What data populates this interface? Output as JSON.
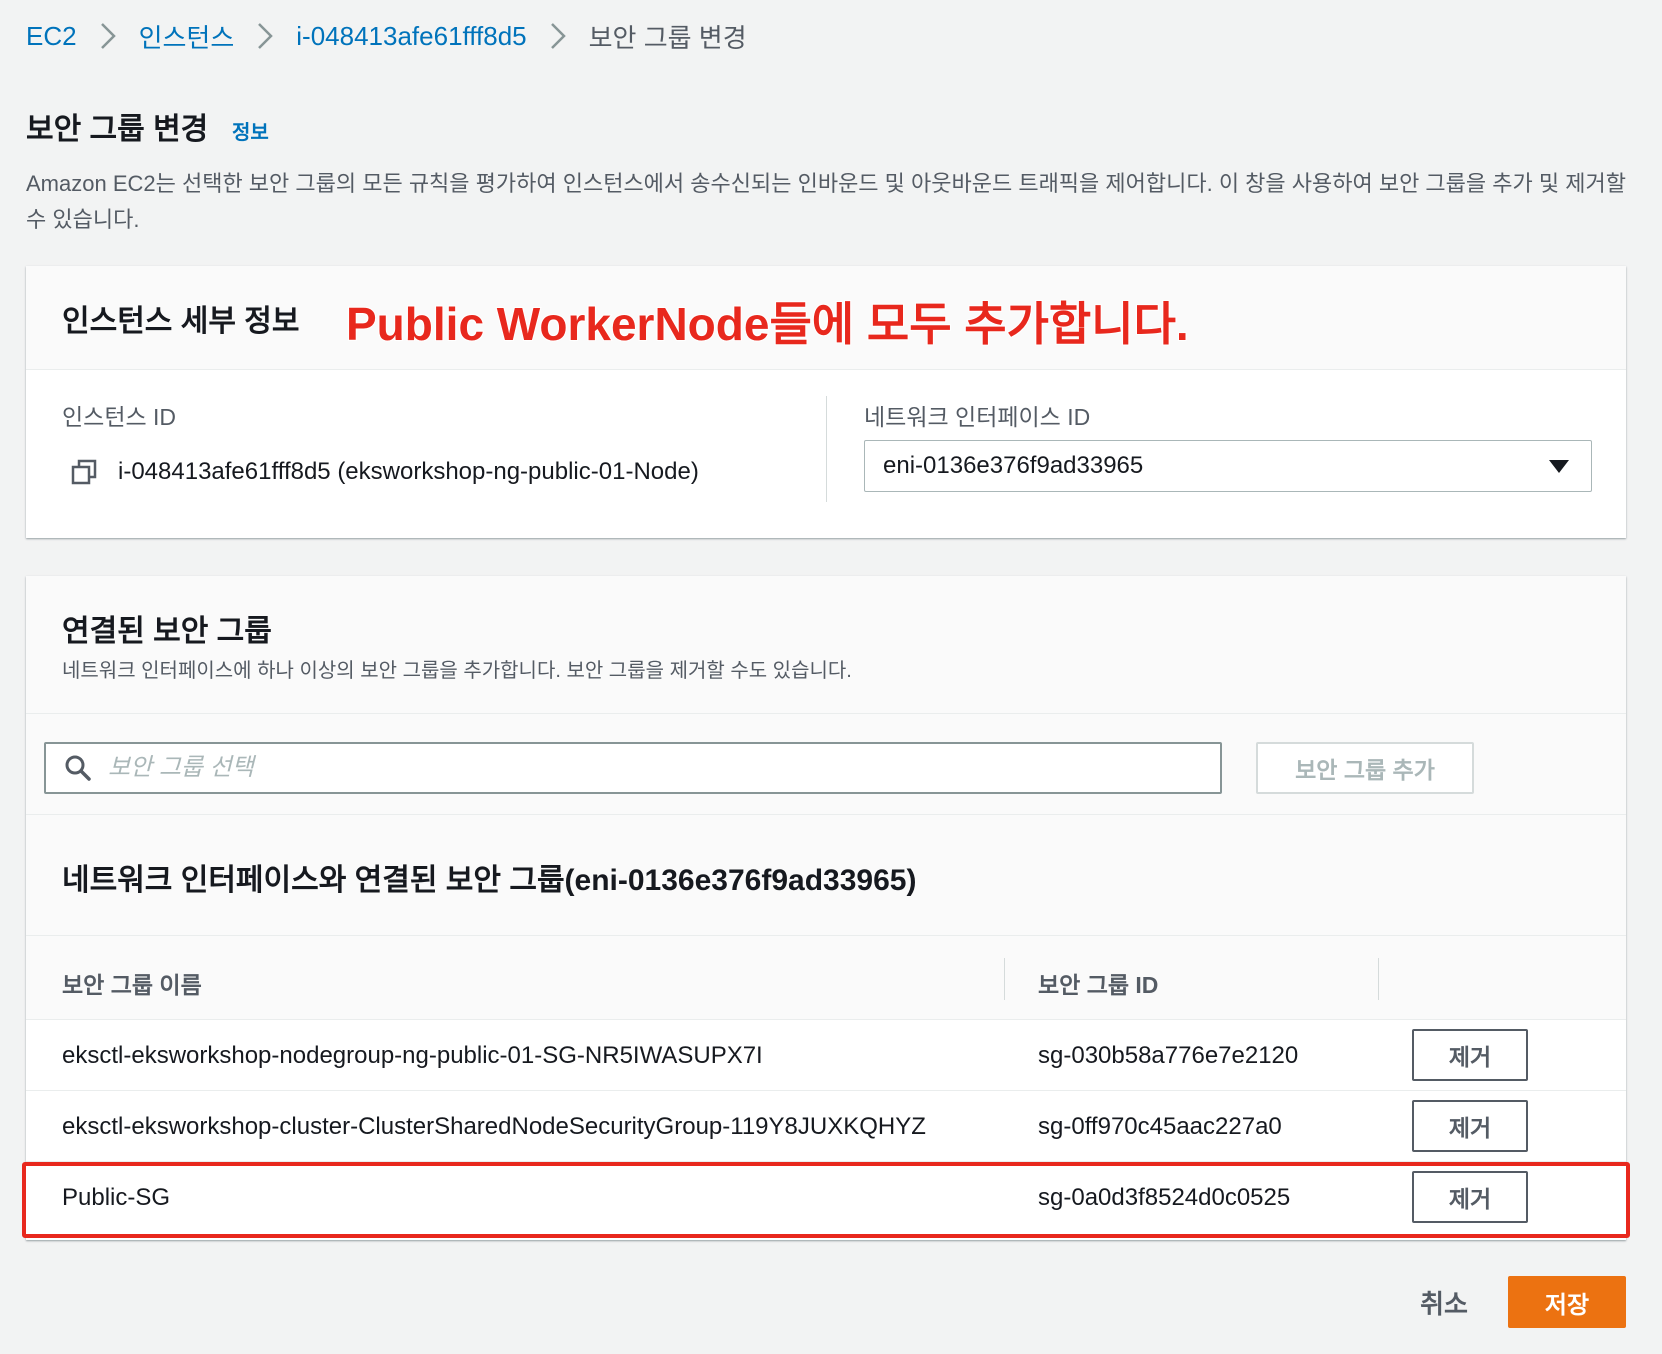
{
  "breadcrumb": {
    "items": [
      "EC2",
      "인스턴스",
      "i-048413afe61fff8d5"
    ],
    "current": "보안 그룹 변경"
  },
  "page": {
    "title": "보안 그룹 변경",
    "info_link": "정보",
    "description": "Amazon EC2는 선택한 보안 그룹의 모든 규칙을 평가하여 인스턴스에서 송수신되는 인바운드 및 아웃바운드 트래픽을 제어합니다. 이 창을 사용하여 보안 그룹을 추가 및 제거할 수 있습니다."
  },
  "instance_details": {
    "title": "인스턴스 세부 정보",
    "annotation": "Public WorkerNode들에 모두 추가합니다.",
    "instance_id_label": "인스턴스 ID",
    "instance_id_value": "i-048413afe61fff8d5 (eksworkshop-ng-public-01-Node)",
    "eni_label": "네트워크 인터페이스 ID",
    "eni_value": "eni-0136e376f9ad33965"
  },
  "security_groups": {
    "title": "연결된 보안 그룹",
    "subtitle": "네트워크 인터페이스에 하나 이상의 보안 그룹을 추가합니다. 보안 그룹을 제거할 수도 있습니다.",
    "search_placeholder": "보안 그룹 선택",
    "add_button": "보안 그룹 추가",
    "table_title": "네트워크 인터페이스와 연결된 보안 그룹(eni-0136e376f9ad33965)",
    "columns": [
      "보안 그룹 이름",
      "보안 그룹 ID"
    ],
    "rows": [
      {
        "name": "eksctl-eksworkshop-nodegroup-ng-public-01-SG-NR5IWASUPX7I",
        "id": "sg-030b58a776e7e2120",
        "action": "제거"
      },
      {
        "name": "eksctl-eksworkshop-cluster-ClusterSharedNodeSecurityGroup-119Y8JUXKQHYZ",
        "id": "sg-0ff970c45aac227a0",
        "action": "제거"
      },
      {
        "name": "Public-SG",
        "id": "sg-0a0d3f8524d0c0525",
        "action": "제거"
      }
    ]
  },
  "footer": {
    "cancel": "취소",
    "save": "저장"
  },
  "colors": {
    "link": "#0073bb",
    "primary_button": "#ec7211",
    "annotation_red": "#e8281d"
  }
}
